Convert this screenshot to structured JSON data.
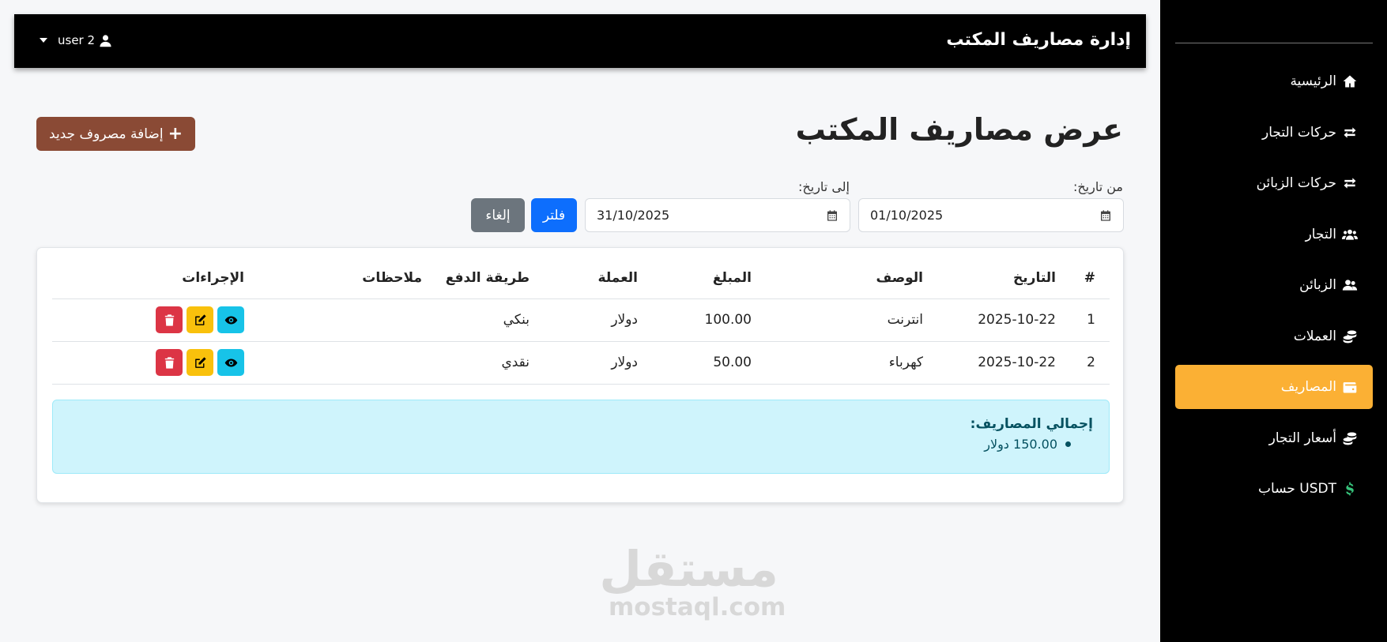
{
  "header": {
    "title": "إدارة مصاريف المكتب",
    "user": "user 2"
  },
  "sidebar": {
    "items": [
      {
        "label": "الرئيسية",
        "icon": "home-icon"
      },
      {
        "label": "حركات التجار",
        "icon": "exchange-icon"
      },
      {
        "label": "حركات الزبائن",
        "icon": "exchange-icon"
      },
      {
        "label": "التجار",
        "icon": "users-icon"
      },
      {
        "label": "الزبائن",
        "icon": "user-group-icon"
      },
      {
        "label": "العملات",
        "icon": "coins-icon"
      },
      {
        "label": "المصاريف",
        "icon": "wallet-icon",
        "active": true
      },
      {
        "label": "أسعار التجار",
        "icon": "coins-icon"
      },
      {
        "label": "حساب USDT",
        "icon": "dollar-icon"
      }
    ],
    "active_color": "#fbb034"
  },
  "page": {
    "title": "عرض مصاريف المكتب",
    "add_label": "إضافة مصروف جديد"
  },
  "filters": {
    "from_label": "من تاريخ:",
    "from_value": "01/10/2025",
    "to_label": "إلى تاريخ:",
    "to_value": "31/10/2025",
    "filter_label": "فلتر",
    "cancel_label": "إلغاء"
  },
  "table": {
    "headers": [
      "#",
      "التاريخ",
      "الوصف",
      "المبلغ",
      "العملة",
      "طريقة الدفع",
      "ملاحظات",
      "الإجراءات"
    ],
    "rows": [
      {
        "num": "1",
        "date": "2025-10-22",
        "desc": "انترنت",
        "amount": "100.00",
        "currency": "دولار",
        "method": "بنكي",
        "notes": ""
      },
      {
        "num": "2",
        "date": "2025-10-22",
        "desc": "كهرباء",
        "amount": "50.00",
        "currency": "دولار",
        "method": "نقدي",
        "notes": ""
      }
    ]
  },
  "summary": {
    "title": "إجمالي المصاريف:",
    "items": [
      "150.00 دولار"
    ]
  },
  "watermark": {
    "arabic": "مستقل",
    "latin": "mostaql.com"
  }
}
